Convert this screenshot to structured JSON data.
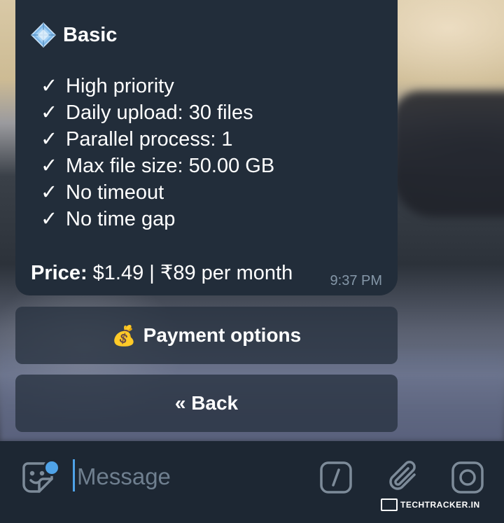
{
  "message": {
    "title": "Basic",
    "title_icon": "diamond-icon",
    "features": [
      "High priority",
      "Daily upload: 30 files",
      "Parallel process: 1",
      "Max file size: 50.00 GB",
      "No timeout",
      "No time gap"
    ],
    "check_glyph": "✓",
    "price_label": "Price:",
    "price_value": " $1.49 | ₹89 per month",
    "time": "9:37 PM"
  },
  "keyboard": {
    "payment_icon": "💰",
    "payment_label": "Payment options",
    "back_label": "« Back"
  },
  "input_bar": {
    "placeholder": "Message",
    "icons": [
      "sticker-icon",
      "bot-command-icon",
      "paperclip-icon",
      "camera-icon"
    ],
    "accent_color": "#4fa3e8"
  },
  "watermark": {
    "text": "TECHTRACKER.IN"
  }
}
